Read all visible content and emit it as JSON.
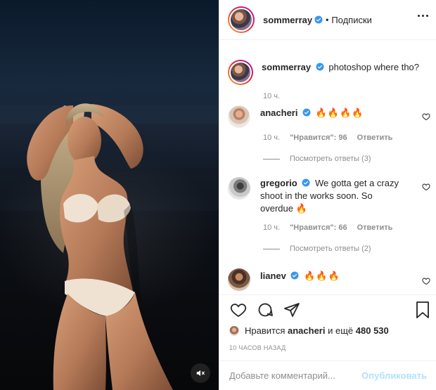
{
  "post": {
    "author": "sommerray",
    "follow_state": "Подписки",
    "caption": "photoshop where tho?",
    "caption_time": "10 ч.",
    "muted": true
  },
  "comments": [
    {
      "username": "anacheri",
      "text": "🔥🔥🔥🔥",
      "time": "10 ч.",
      "likes_label": "\"Нравится\": 96",
      "reply_label": "Ответить",
      "view_replies": "Посмотреть ответы (3)"
    },
    {
      "username": "gregorio",
      "text_line1": "We gotta get a crazy",
      "text_line2": "shoot in the works soon. So",
      "text_line3": "overdue 🔥",
      "time": "10 ч.",
      "likes_label": "\"Нравится\": 66",
      "reply_label": "Ответить",
      "view_replies": "Посмотреть ответы (2)"
    },
    {
      "username": "lianev",
      "text": "🔥🔥🔥"
    }
  ],
  "likes": {
    "prefix": "Нравится",
    "user": "anacheri",
    "middle": "и ещё",
    "count": "480 530"
  },
  "timestamp": "10 ЧАСОВ НАЗАД",
  "add_comment": {
    "placeholder": "Добавьте комментарий...",
    "publish_label": "Опубликовать"
  },
  "colors": {
    "verified": "#3897f0",
    "publish_disabled": "#b2dffc",
    "meta_gray": "#8e8e8e",
    "flame": "#f26a1b"
  },
  "icons": [
    "verified-icon",
    "more-icon",
    "heart-icon",
    "comment-icon",
    "share-icon",
    "bookmark-icon",
    "mute-icon"
  ]
}
